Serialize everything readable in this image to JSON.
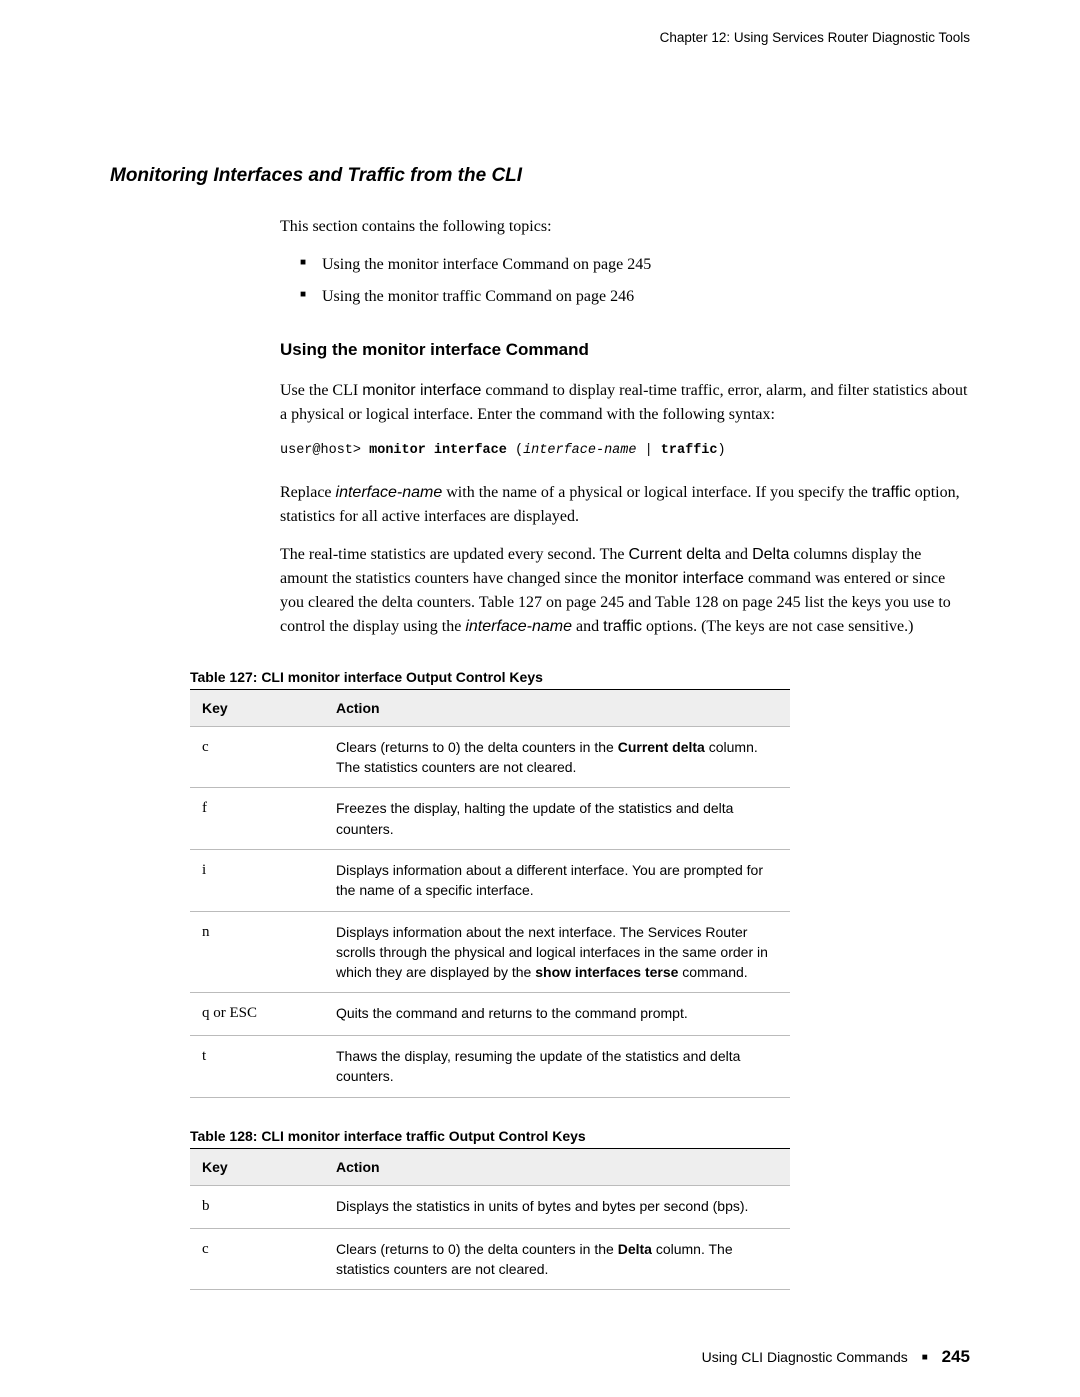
{
  "running_header": "Chapter 12: Using Services Router Diagnostic Tools",
  "section_heading": "Monitoring Interfaces and Traffic from the CLI",
  "intro_para": "This section contains the following topics:",
  "topics": [
    "Using the monitor interface Command on page 245",
    "Using the monitor traffic Command on page 246"
  ],
  "subsection_heading": "Using the monitor interface Command",
  "para1_pre": "Use the CLI ",
  "para1_cmd": "monitor interface",
  "para1_post": " command to display real-time traffic, error, alarm, and filter statistics about a physical or logical interface. Enter the command with the following syntax:",
  "code_prompt": "user@host> ",
  "code_cmd": "monitor interface",
  "code_open": " (",
  "code_arg": "interface-name",
  "code_pipe": " | ",
  "code_opt": "traffic",
  "code_close": ")",
  "para2_a": "Replace ",
  "para2_iname": "interface-name",
  "para2_b": " with the name of a physical or logical interface. If you specify the ",
  "para2_traffic": "traffic",
  "para2_c": " option, statistics for all active interfaces are displayed.",
  "para3_a": "The real-time statistics are updated every second. The ",
  "para3_curdelta": "Current delta",
  "para3_b": " and ",
  "para3_delta": "Delta",
  "para3_c": " columns display the amount the statistics counters have changed since the ",
  "para3_cmd": "monitor interface",
  "para3_d": " command was entered or since you cleared the delta counters. Table 127 on page 245 and Table 128 on page 245 list the keys you use to control the display using the ",
  "para3_iname": "interface-name",
  "para3_e": " and ",
  "para3_traffic": "traffic",
  "para3_f": " options. (The keys are not case sensitive.)",
  "table127": {
    "title": "Table 127: CLI monitor interface Output Control Keys",
    "headers": {
      "key": "Key",
      "action": "Action"
    },
    "rows": [
      {
        "key": "c",
        "action_a": "Clears (returns to 0) the delta counters in the ",
        "action_bold": "Current delta",
        "action_b": " column. The statistics counters are not cleared."
      },
      {
        "key": "f",
        "action_a": "Freezes the display, halting the update of the statistics and delta counters.",
        "action_bold": "",
        "action_b": ""
      },
      {
        "key": "i",
        "action_a": "Displays information about a different interface. You are prompted for the name of a specific interface.",
        "action_bold": "",
        "action_b": ""
      },
      {
        "key": "n",
        "action_a": "Displays information about the next interface. The Services Router scrolls through the physical and logical interfaces in the same order in which they are displayed by the ",
        "action_bold": "show interfaces terse",
        "action_b": " command."
      },
      {
        "key": "q or ESC",
        "action_a": "Quits the command and returns to the command prompt.",
        "action_bold": "",
        "action_b": ""
      },
      {
        "key": "t",
        "action_a": "Thaws the display, resuming the update of the statistics and delta counters.",
        "action_bold": "",
        "action_b": ""
      }
    ]
  },
  "table128": {
    "title": "Table 128:  CLI monitor interface traffic Output Control Keys",
    "headers": {
      "key": "Key",
      "action": "Action"
    },
    "rows": [
      {
        "key": "b",
        "action_a": "Displays the statistics in units of bytes and bytes per second (bps).",
        "action_bold": "",
        "action_b": ""
      },
      {
        "key": "c",
        "action_a": "Clears (returns to 0) the delta counters in the ",
        "action_bold": "Delta",
        "action_b": " column. The statistics counters are not cleared."
      }
    ]
  },
  "footer": {
    "text": "Using CLI Diagnostic Commands",
    "page": "245"
  }
}
